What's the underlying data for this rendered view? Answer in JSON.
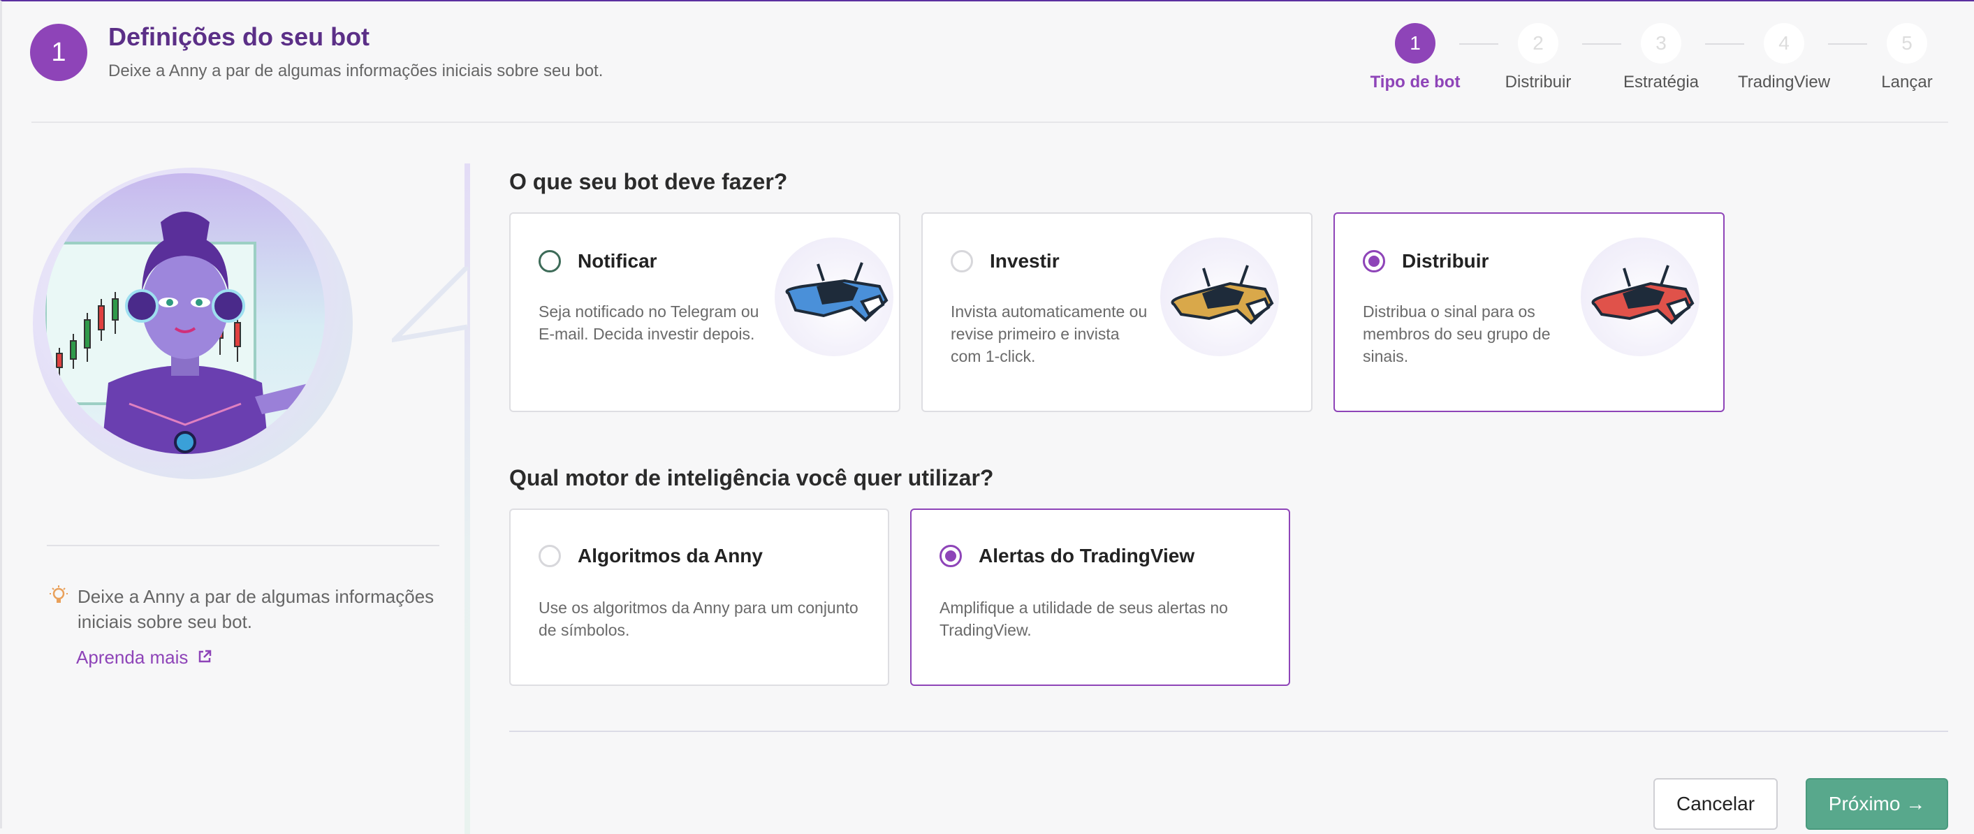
{
  "header": {
    "step_number": "1",
    "title": "Definições do seu bot",
    "subtitle": "Deixe a Anny a par de algumas informações iniciais sobre seu bot."
  },
  "stepper": {
    "steps": [
      {
        "number": "1",
        "label": "Tipo de bot",
        "active": true
      },
      {
        "number": "2",
        "label": "Distribuir",
        "active": false
      },
      {
        "number": "3",
        "label": "Estratégia",
        "active": false
      },
      {
        "number": "4",
        "label": "TradingView",
        "active": false
      },
      {
        "number": "5",
        "label": "Lançar",
        "active": false
      }
    ]
  },
  "sidebar": {
    "tip": "Deixe a Anny a par de algumas informações iniciais sobre seu bot.",
    "learn_more": "Aprenda mais",
    "tip_icon": "lightbulb-icon",
    "link_icon": "external-link-icon"
  },
  "section1": {
    "title": "O que seu bot deve fazer?",
    "options": [
      {
        "title": "Notificar",
        "description": "Seja notificado no Telegram ou E-mail. Decida investir depois.",
        "selected": false,
        "color": "#4a90d9"
      },
      {
        "title": "Investir",
        "description": "Invista automaticamente ou revise primeiro e invista com 1-click.",
        "selected": false,
        "color": "#d9a84a"
      },
      {
        "title": "Distribuir",
        "description": "Distribua o sinal para os membros do seu grupo de sinais.",
        "selected": true,
        "color": "#e0524a"
      }
    ]
  },
  "section2": {
    "title": "Qual motor de inteligência você quer utilizar?",
    "options": [
      {
        "title": "Algoritmos da Anny",
        "description": "Use os algoritmos da Anny para um conjunto de símbolos.",
        "selected": false
      },
      {
        "title": "Alertas do TradingView",
        "description": "Amplifique a utilidade de seus alertas no TradingView.",
        "selected": true
      }
    ]
  },
  "footer": {
    "cancel": "Cancelar",
    "next": "Próximo →"
  },
  "colors": {
    "accent": "#8e44b8",
    "next_button": "#58a88c"
  }
}
